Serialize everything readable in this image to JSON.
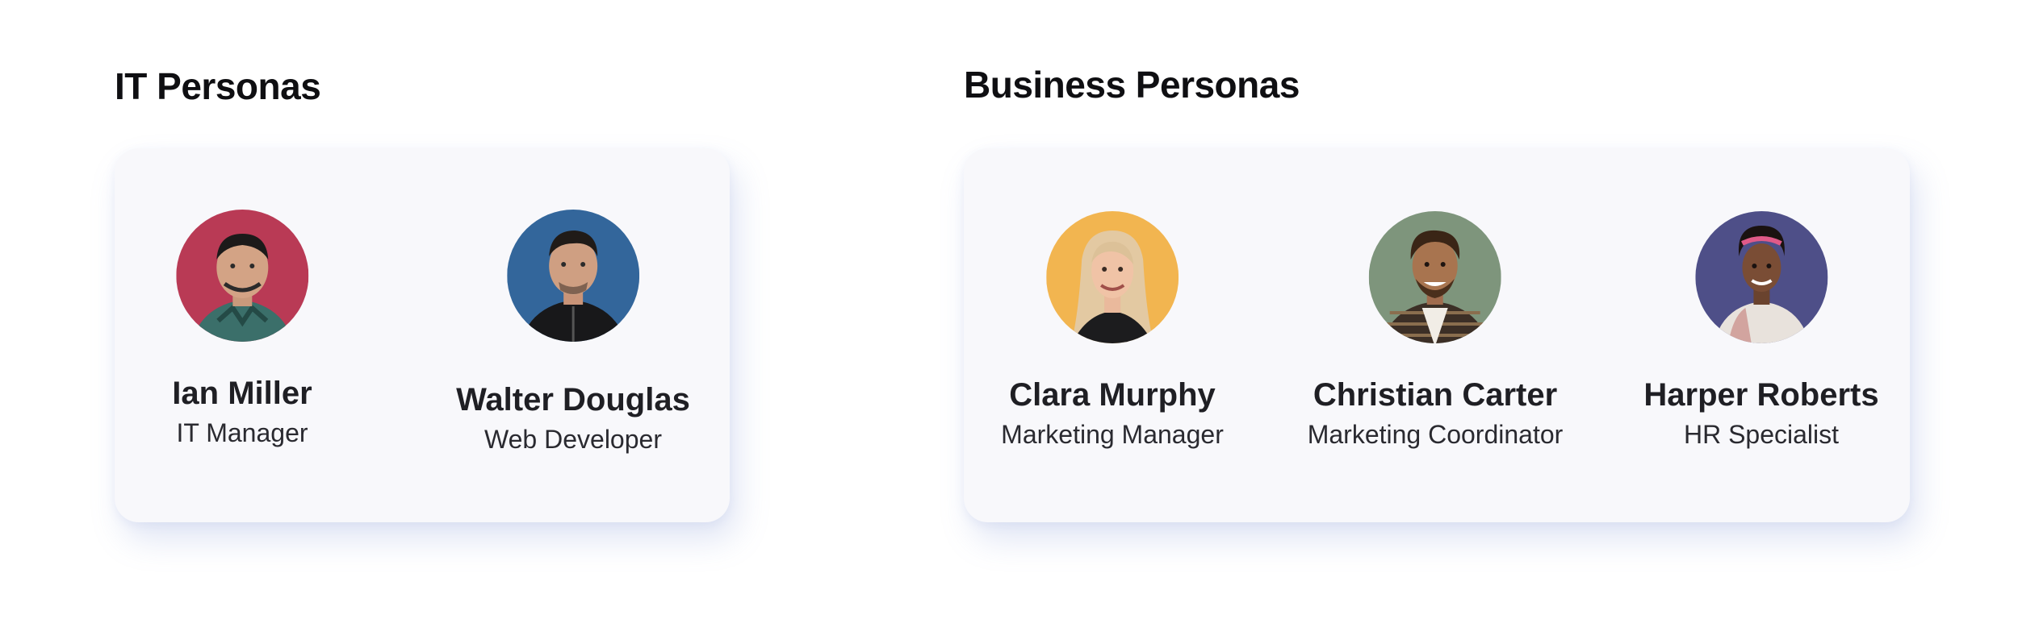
{
  "it": {
    "title": "IT Personas",
    "personas": [
      {
        "name": "Ian Miller",
        "role": "IT Manager",
        "avatar_bg": "#b93a55",
        "avatar_icon": "person-portrait"
      },
      {
        "name": "Walter Douglas",
        "role": "Web Developer",
        "avatar_bg": "#33669b",
        "avatar_icon": "person-portrait"
      }
    ]
  },
  "business": {
    "title": "Business Personas",
    "personas": [
      {
        "name": "Clara Murphy",
        "role": "Marketing Manager",
        "avatar_bg": "#f2b550",
        "avatar_icon": "person-portrait"
      },
      {
        "name": "Christian Carter",
        "role": "Marketing Coordinator",
        "avatar_bg": "#7e957c",
        "avatar_icon": "person-portrait"
      },
      {
        "name": "Harper Roberts",
        "role": "HR Specialist",
        "avatar_bg": "#4e4f88",
        "avatar_icon": "person-portrait"
      }
    ]
  }
}
